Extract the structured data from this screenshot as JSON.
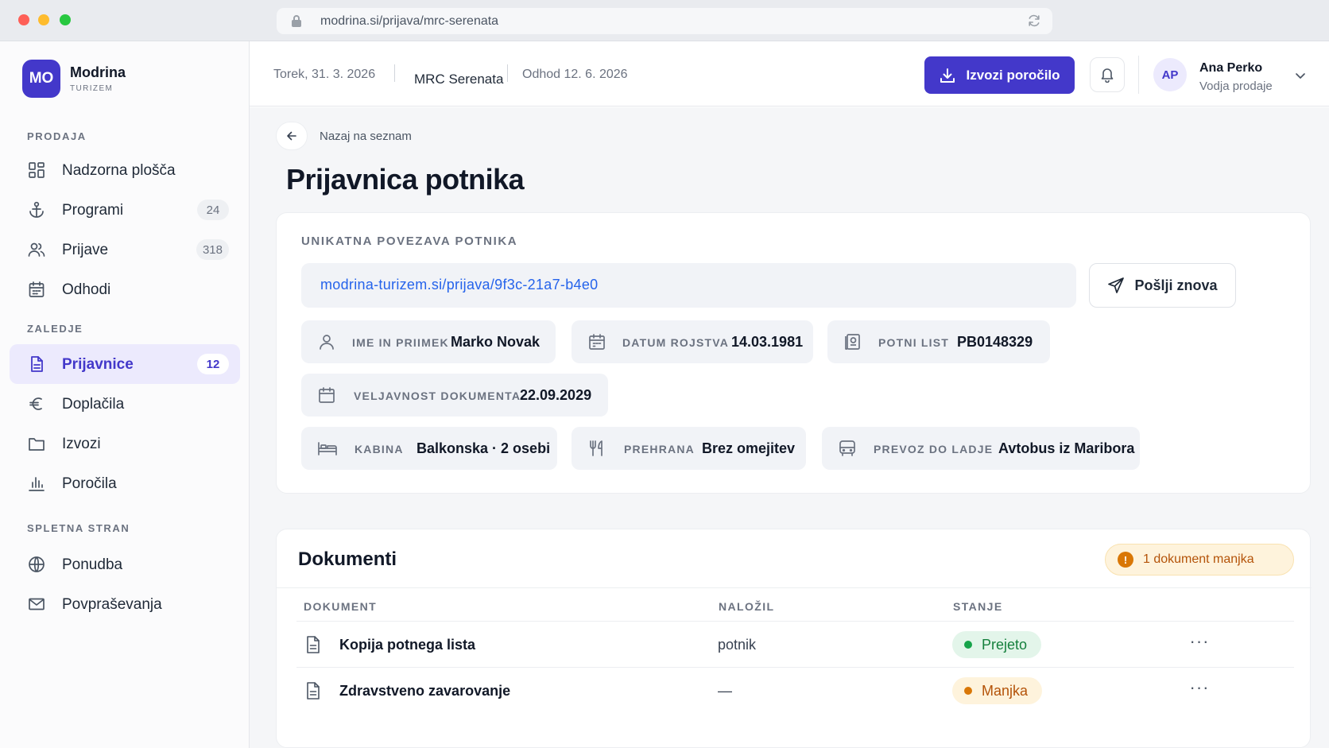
{
  "browser": {
    "url": "modrina.si/prijava/mrc-serenata"
  },
  "brand": {
    "logo_text": "MO",
    "name": "Modrina",
    "subtitle": "TURIZEM",
    "accent": "#4338ca"
  },
  "sidebar": {
    "sections": [
      {
        "title": "PRODAJA",
        "items": [
          {
            "label": "Nadzorna plošča",
            "icon": "dashboard-icon"
          },
          {
            "label": "Programi",
            "icon": "anchor-icon",
            "count": "24"
          },
          {
            "label": "Prijave",
            "icon": "users-icon",
            "count": "318"
          },
          {
            "label": "Odhodi",
            "icon": "calendar-icon"
          }
        ]
      },
      {
        "title": "ZALEDJE",
        "items": [
          {
            "label": "Prijavnice",
            "icon": "document-icon",
            "count": "12",
            "active": true
          },
          {
            "label": "Doplačila",
            "icon": "euro-icon"
          },
          {
            "label": "Izvozi",
            "icon": "folder-icon"
          },
          {
            "label": "Poročila",
            "icon": "bar-chart-icon"
          }
        ]
      },
      {
        "title": "SPLETNA STRAN",
        "items": [
          {
            "label": "Ponudba",
            "icon": "globe-icon"
          },
          {
            "label": "Povpraševanja",
            "icon": "mail-icon"
          }
        ]
      }
    ]
  },
  "topbar": {
    "date": "Torek, 31. 3. 2026",
    "ship": "MRC Serenata",
    "departure": "Odhod 12. 6. 2026",
    "export_label": "Izvozi poročilo",
    "user": {
      "initials": "AP",
      "name": "Ana Perko",
      "role": "Vodja prodaje"
    }
  },
  "page": {
    "back_label": "Nazaj na seznam",
    "title": "Prijavnica potnika"
  },
  "passenger": {
    "link_label": "UNIKATNA POVEZAVA POTNIKA",
    "link": "modrina-turizem.si/prijava/9f3c-21a7-b4e0",
    "resend_label": "Pošlji znova",
    "fields": {
      "name": {
        "key": "IME IN PRIIMEK",
        "value": "Marko Novak",
        "icon": "person-icon"
      },
      "dob": {
        "key": "DATUM ROJSTVA",
        "value": "14.03.1981",
        "icon": "calendar-icon"
      },
      "passport": {
        "key": "POTNI LIST",
        "value": "PB0148329",
        "icon": "passport-icon"
      },
      "validity": {
        "key": "VELJAVNOST DOKUMENTA",
        "value": "22.09.2029",
        "icon": "calendar-icon"
      },
      "cabin": {
        "key": "KABINA",
        "value": "Balkonska · 2 osebi",
        "icon": "bed-icon"
      },
      "diet": {
        "key": "PREHRANA",
        "value": "Brez omejitev",
        "icon": "fork-knife-icon"
      },
      "transfer": {
        "key": "PREVOZ DO LADJE",
        "value": "Avtobus iz Maribora",
        "icon": "bus-icon"
      }
    }
  },
  "documents": {
    "title": "Dokumenti",
    "missing_badge": "1 dokument manjka",
    "columns": {
      "document": "DOKUMENT",
      "uploader": "NALOŽIL",
      "status": "STANJE"
    },
    "rows": [
      {
        "name": "Kopija potnega lista",
        "uploader": "potnik",
        "status": "Prejeto"
      },
      {
        "name": "Zdravstveno zavarovanje",
        "uploader": "—",
        "status": "Manjka"
      }
    ]
  }
}
